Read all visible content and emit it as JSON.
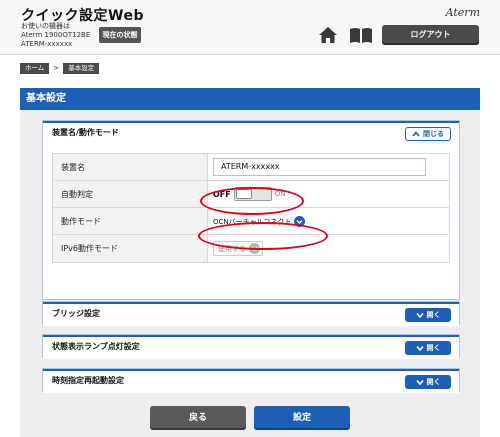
{
  "header": {
    "app_title": "クイック設定Web",
    "device_line1": "お使いの機器は",
    "device_line2": "Aterm 1900OT12BE",
    "device_line3": "ATERM-xxxxxx",
    "status_button": "現在の状態",
    "brand_logo": "Aterm",
    "logout_button": "ログアウト"
  },
  "breadcrumb": {
    "home": "ホーム",
    "separator": ">",
    "current": "基本設定"
  },
  "section_title": "基本設定",
  "panels": {
    "device": {
      "title": "装置名/動作モード",
      "toggle_label": "閉じる",
      "rows": {
        "device_name_label": "装置名",
        "device_name_value": "ATERM-xxxxxx",
        "auto_detect_label": "自動判定",
        "auto_detect_off": "OFF",
        "auto_detect_on": "ON",
        "mode_label": "動作モード",
        "mode_value": "OCNバーチャルコネクト",
        "ipv6_label": "IPv6動作モード",
        "ipv6_value": "使用する"
      }
    },
    "bridge": {
      "title": "ブリッジ設定",
      "toggle_label": "開く"
    },
    "lamp": {
      "title": "状態表示ランプ点灯設定",
      "toggle_label": "開く"
    },
    "reboot": {
      "title": "時刻指定再起動設定",
      "toggle_label": "開く"
    }
  },
  "footer": {
    "back_button": "戻る",
    "save_button": "設定"
  },
  "colors": {
    "accent_blue": "#1d5fb6",
    "highlight_red": "#e0001a",
    "dark_button": "#4a4a4a"
  }
}
